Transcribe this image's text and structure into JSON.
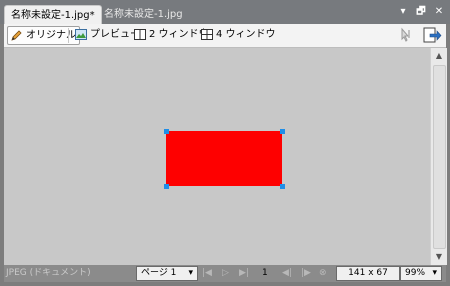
{
  "tabs": [
    {
      "label": "名称未設定-1.jpg*",
      "active": true
    },
    {
      "label": "名称未設定-1.jpg",
      "active": false
    }
  ],
  "window_controls": {
    "dropdown": "▾",
    "restore": "🗗",
    "close": "✕"
  },
  "toolbar": {
    "original": "オリジナル",
    "preview": "プレビュー",
    "two_window": "2 ウィンドウ",
    "four_window": "4 ウィンドウ"
  },
  "canvas": {
    "background": "#c8c8c8",
    "shape_color": "#fe0000",
    "handle_color": "#1f8ee8"
  },
  "status": {
    "format": "JPEG (ドキュメント)",
    "page": "ページ 1",
    "page_number": "1",
    "size": "141 x 67",
    "zoom": "99%"
  },
  "icons": [
    "pencil-icon",
    "image-icon",
    "two-window-icon",
    "four-window-icon",
    "pointer-tool-icon",
    "export-icon"
  ]
}
